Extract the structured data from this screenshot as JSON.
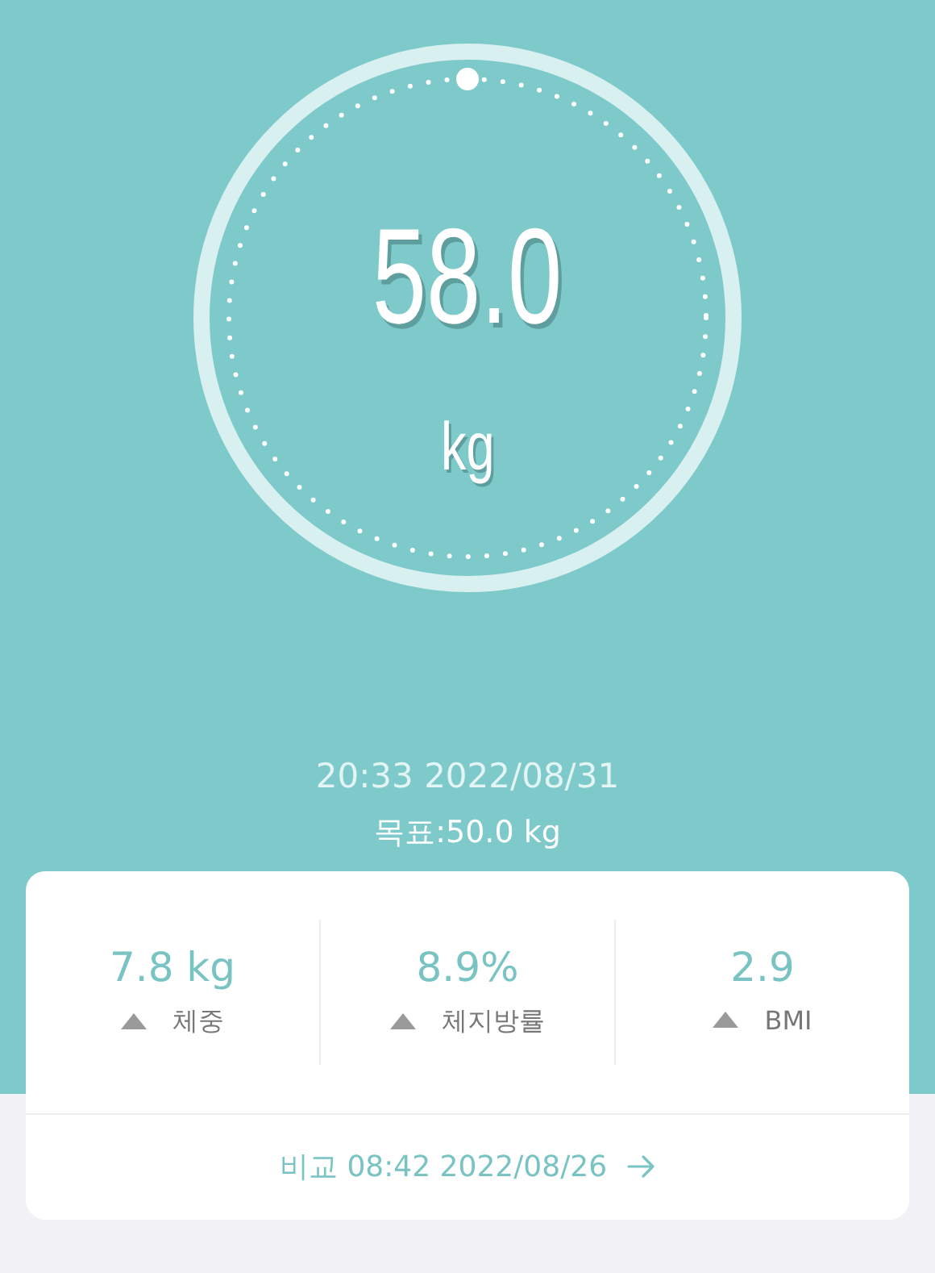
{
  "gauge": {
    "value": "58.0",
    "unit": "kg"
  },
  "measured_at": "20:33 2022/08/31",
  "goal": "목표:50.0 kg",
  "changes": [
    {
      "value": "7.8 kg",
      "increased": true,
      "label": "체중"
    },
    {
      "value": "8.9%",
      "increased": true,
      "label": "체지방률"
    },
    {
      "value": "2.9",
      "increased": true,
      "label": "BMI"
    }
  ],
  "compare_link": "비교 08:42 2022/08/26"
}
